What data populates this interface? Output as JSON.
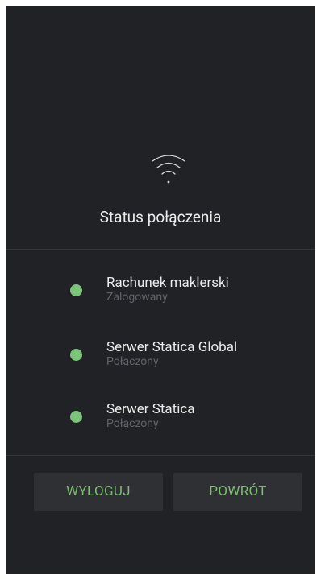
{
  "header": {
    "icon": "wifi-icon",
    "title": "Status połączenia"
  },
  "status_items": [
    {
      "label": "Rachunek maklerski",
      "sub": "Zalogowany",
      "status_color": "#7cc47a"
    },
    {
      "label": "Serwer Statica Global",
      "sub": "Połączony",
      "status_color": "#7cc47a"
    },
    {
      "label": "Serwer Statica",
      "sub": "Połączony",
      "status_color": "#7cc47a"
    }
  ],
  "buttons": {
    "logout_label": "WYLOGUJ",
    "back_label": "POWRÓT"
  },
  "colors": {
    "background": "#212225",
    "accent": "#7ebd72",
    "status_ok": "#7cc47a"
  }
}
